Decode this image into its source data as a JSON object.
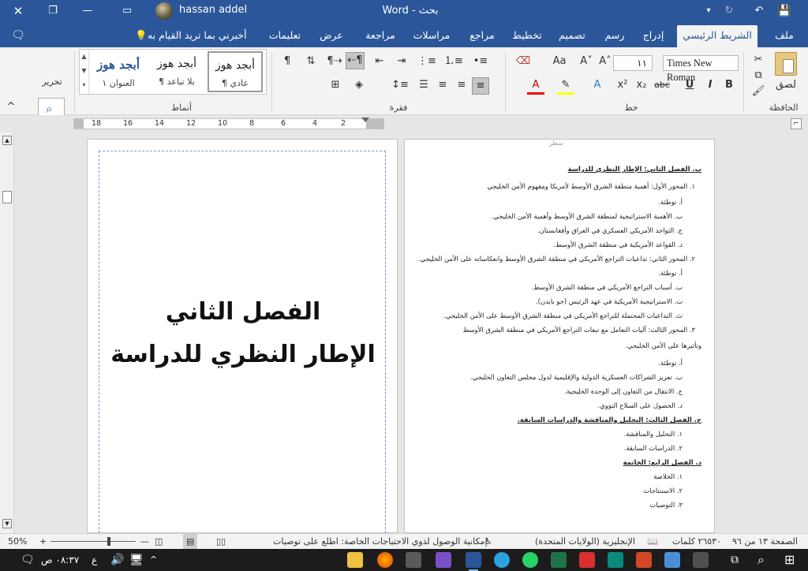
{
  "titlebar": {
    "username": "hassan addel",
    "app_name": "Word",
    "separator": "-",
    "doc_name": "بحث",
    "ribbon_options_glyph": "▭",
    "share_glyph": "▢",
    "close_glyph": "✕",
    "minimize_glyph": "—",
    "restore_glyph": "❐",
    "save_glyph": "💾",
    "undo_glyph": "↶",
    "redo_glyph": "↻",
    "customize_glyph": "▾"
  },
  "tabs": {
    "file": "ملف",
    "home": "الشريط الرئيسي",
    "insert": "إدراج",
    "draw": "رسم",
    "design": "تصميم",
    "layout": "تخطيط",
    "references": "مراجع",
    "mailings": "مراسلات",
    "review": "مراجعة",
    "view": "عرض",
    "help": "تعليمات",
    "tell_me": "أخبرني بما تريد القيام به",
    "comment_glyph": "🗨"
  },
  "ribbon": {
    "clipboard_label": "الحافظة",
    "paste_label": "لصق",
    "font_label": "خط",
    "font_name": "Times New Roman",
    "font_size": "١١",
    "paragraph_label": "فقرة",
    "styles_label": "أنماط",
    "editing_label": "تحرير",
    "styles": [
      {
        "preview": "أبجد هوز",
        "name": "¶ عادي"
      },
      {
        "preview": "أبجد هوز",
        "name": "¶ بلا تباعد"
      },
      {
        "preview": "أبجد هوز",
        "name": "العنوان ١"
      }
    ],
    "bold": "B",
    "italic": "I",
    "underline": "U",
    "strikethrough": "abc",
    "subscript": "x₂",
    "superscript": "x²",
    "grow_font": "A˄",
    "shrink_font": "A˅",
    "change_case": "Aa",
    "pilcrow": "¶",
    "collapse_glyph": "^"
  },
  "ruler": {
    "numbers": [
      "2",
      "4",
      "6",
      "8",
      "10",
      "12",
      "14",
      "16",
      "18"
    ]
  },
  "left_page": {
    "title_line1": "الفصل الثاني",
    "title_line2": "الإطار النظري للدراسة"
  },
  "right_page": {
    "header_mark": "سطر",
    "lines": [
      "ب. الفصل الثاني: الإطار النظري للدراسة",
      "١. المحور الأول: أهمية منطقة الشرق الأوسط لأمريكا ومفهوم الأمن الخليجي",
      "أ. توطئة.",
      "ب. الأهمية الاستراتيجية لمنطقة الشرق الأوسط وأهمية الأمن الخليجي.",
      "ج. التواجد الأمريكي العسكري في العراق وأفغانستان.",
      "د. القواعد الأمريكية في منطقة الشرق الأوسط.",
      "٢. المحور الثاني: تداعيات التراجع الأمريكي في منطقة الشرق الأوسط وانعكاساته على الأمن الخليجي.",
      "أ. توطئة.",
      "ب. أسباب التراجع الأمريكي في منطقة الشرق الأوسط.",
      "ت. الاستراتيجية الأمريكية في عهد الرئيس (جو بايدن).",
      "ث. التداعيات المحتملة للتراجع الأمريكي في منطقة الشرق الأوسط على الأمن الخليجي.",
      "٣. المحور الثالث: آليات التعامل مع تبعات التراجع الأمريكي في منطقة الشرق الأوسط",
      "وتأثيرها على الأمن الخليجي.",
      "أ. توطئة.",
      "ب. تعزيز الشراكات العسكرية الدولية والإقليمية لدول مجلس التعاون الخليجي.",
      "ج. الانتقال من التعاون إلى الوحدة الخليجية.",
      "د. الحصول على السلاح النووي.",
      "ج. الفصل الثالث: التحليل والمناقشة والدراسات السابقة.",
      "١. التحليل والمناقشة.",
      "٢. الدراسات السابقة.",
      "د. الفصل الرابع: الخاتمة",
      "١. الخلاصة",
      "٢. الاستنتاجات",
      "٣. التوصيات"
    ]
  },
  "statusbar": {
    "page": "الصفحة ١٣ من ٩٦",
    "words": "٢٦٥٣٠ كلمات",
    "language": "الإنجليزية (الولايات المتحدة)",
    "accessibility": "إمكانية الوصول لذوي الاحتياجات الخاصة: اطلع على توصيات",
    "zoom": "50%",
    "zoom_minus": "—",
    "zoom_plus": "+"
  },
  "taskbar": {
    "time": "٠٨:٣٧ ص",
    "lang": "ع",
    "search_glyph": "⌕",
    "start_glyph": "⊞"
  },
  "colors": {
    "word_blue": "#2b579a",
    "taskbar": "#1c1c1c"
  }
}
